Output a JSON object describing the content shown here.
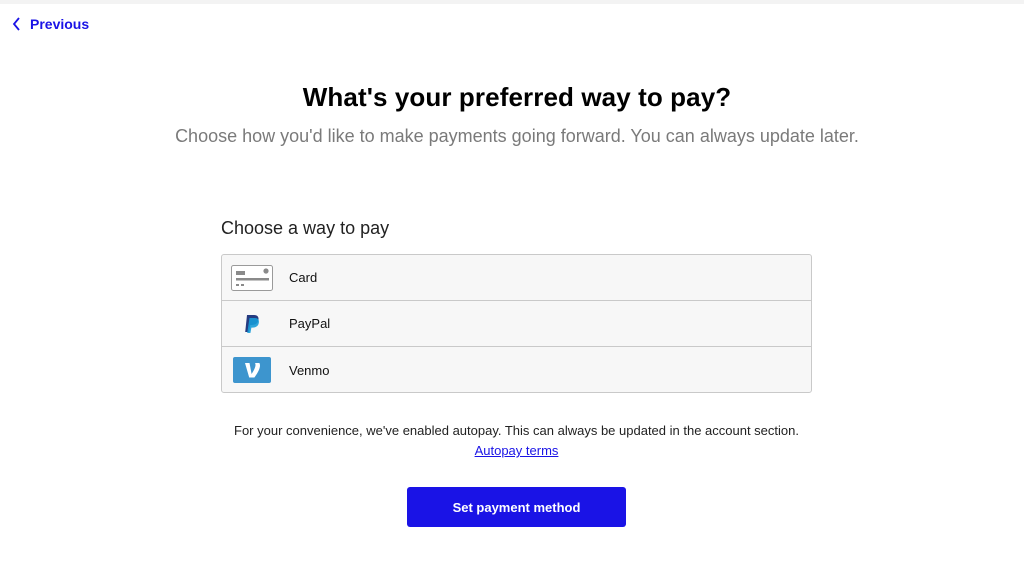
{
  "nav": {
    "previous_label": "Previous"
  },
  "header": {
    "title": "What's your preferred way to pay?",
    "subtitle": "Choose how you'd like to make payments going forward. You can always update later."
  },
  "payment": {
    "section_label": "Choose a way to pay",
    "methods": [
      {
        "label": "Card",
        "icon": "credit-card-icon"
      },
      {
        "label": "PayPal",
        "icon": "paypal-logo-icon"
      },
      {
        "label": "Venmo",
        "icon": "venmo-logo-icon"
      }
    ]
  },
  "notice": {
    "text": "For your convenience, we've enabled autopay. This can always be updated in the account section.",
    "link_label": "Autopay terms"
  },
  "actions": {
    "submit_label": "Set payment method"
  },
  "colors": {
    "accent": "#1a13e6",
    "venmo": "#3d95ce",
    "paypal_dark": "#253b80",
    "paypal_light": "#179bd7"
  }
}
